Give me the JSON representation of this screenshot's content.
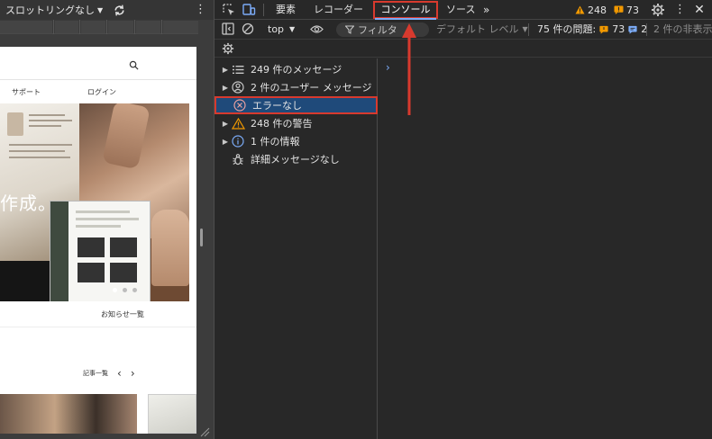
{
  "device_toolbar": {
    "throttling_label": "スロットリングなし",
    "more_icon": "more-vertical-icon"
  },
  "site": {
    "nav_support": "サポート",
    "nav_login": "ログイン",
    "hero_text": "作成。",
    "news_link": "お知らせ一覧",
    "articles_label": "記事一覧",
    "prev_arrow": "‹",
    "next_arrow": "›"
  },
  "devtools": {
    "tabs": {
      "elements": "要素",
      "recorder": "レコーダー",
      "console": "コンソール",
      "sources": "ソース",
      "more": "»"
    },
    "warning_count": "248",
    "issue_count": "73",
    "filterbar": {
      "context": "top",
      "context_caret": "▼",
      "filter_placeholder": "フィルタ",
      "levels": "デフォルト レベル",
      "levels_caret": "▼",
      "issues_label": "75 件の問題:",
      "issues_warn": "73",
      "issues_info": "2",
      "hidden": "2 件の非表示"
    },
    "sidebar": {
      "messages": "249 件のメッセージ",
      "user_messages": "2 件のユーザー メッセージ",
      "errors": "エラーなし",
      "warnings": "248 件の警告",
      "info": "1 件の情報",
      "verbose": "詳細メッセージなし"
    },
    "prompt": "›"
  },
  "colors": {
    "highlight_border": "#d83a2e",
    "selected_bg": "#1f4a7a",
    "accent_blue": "#7cacf8",
    "warning_orange": "#f29900"
  }
}
